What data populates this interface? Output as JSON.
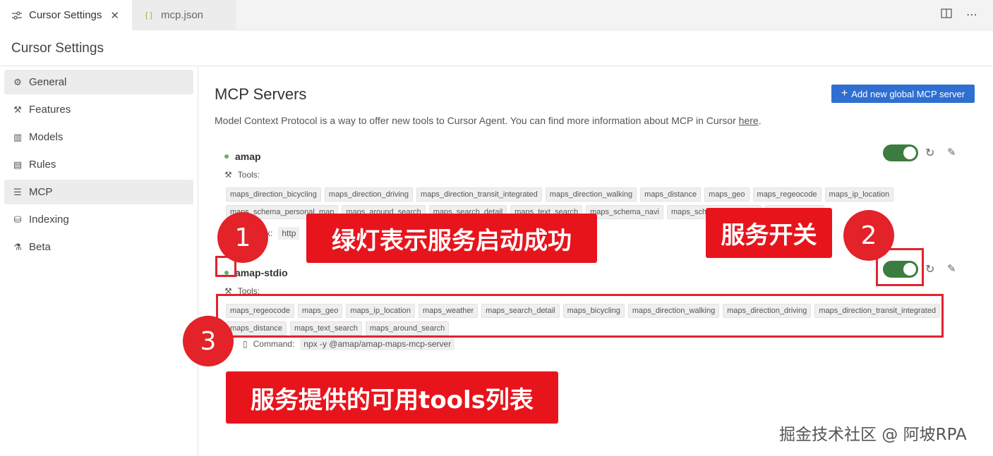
{
  "tabs": [
    {
      "label": "Cursor Settings",
      "icon": "settings-sliders-icon",
      "active": true
    },
    {
      "label": "mcp.json",
      "icon": "json-braces-icon",
      "active": false
    }
  ],
  "header": {
    "title": "Cursor Settings"
  },
  "sidebar": {
    "items": [
      {
        "label": "General",
        "icon": "gear-icon"
      },
      {
        "label": "Features",
        "icon": "tools-icon"
      },
      {
        "label": "Models",
        "icon": "bar-chart-icon"
      },
      {
        "label": "Rules",
        "icon": "document-icon"
      },
      {
        "label": "MCP",
        "icon": "server-icon"
      },
      {
        "label": "Indexing",
        "icon": "database-icon"
      },
      {
        "label": "Beta",
        "icon": "flask-icon"
      }
    ],
    "active_index": 4
  },
  "main": {
    "title": "MCP Servers",
    "add_button": "Add new global MCP server",
    "description_text": "Model Context Protocol is a way to offer new tools to Cursor Agent. You can find more information about MCP in Cursor ",
    "description_link": "here",
    "description_end": "."
  },
  "servers": [
    {
      "name": "amap",
      "status": "green",
      "enabled": true,
      "tools_label": "Tools:",
      "tools": [
        "maps_direction_bicycling",
        "maps_direction_driving",
        "maps_direction_transit_integrated",
        "maps_direction_walking",
        "maps_distance",
        "maps_geo",
        "maps_regeocode",
        "maps_ip_location",
        "maps_schema_personal_map",
        "maps_around_search",
        "maps_search_detail",
        "maps_text_search",
        "maps_schema_navi",
        "maps_schema_take_taxi",
        "maps_weather"
      ],
      "link_label": "Link:",
      "link_value": "http"
    },
    {
      "name": "amap-stdio",
      "status": "green",
      "enabled": true,
      "tools_label": "Tools:",
      "tools": [
        "maps_regeocode",
        "maps_geo",
        "maps_ip_location",
        "maps_weather",
        "maps_search_detail",
        "maps_bicycling",
        "maps_direction_walking",
        "maps_direction_driving",
        "maps_direction_transit_integrated",
        "maps_distance",
        "maps_text_search",
        "maps_around_search"
      ],
      "command_label": "Command:",
      "command_value": "npx -y @amap/amap-maps-mcp-server"
    }
  ],
  "annotations": {
    "badge1": "1",
    "badge2": "2",
    "badge3": "3",
    "callout_green_light": "绿灯表示服务启动成功",
    "callout_switch": "服务开关",
    "callout_tools": "服务提供的可用tools列表",
    "accent_color": "#e8141c"
  },
  "watermark": "掘金技术社区 @ 阿坡RPA"
}
